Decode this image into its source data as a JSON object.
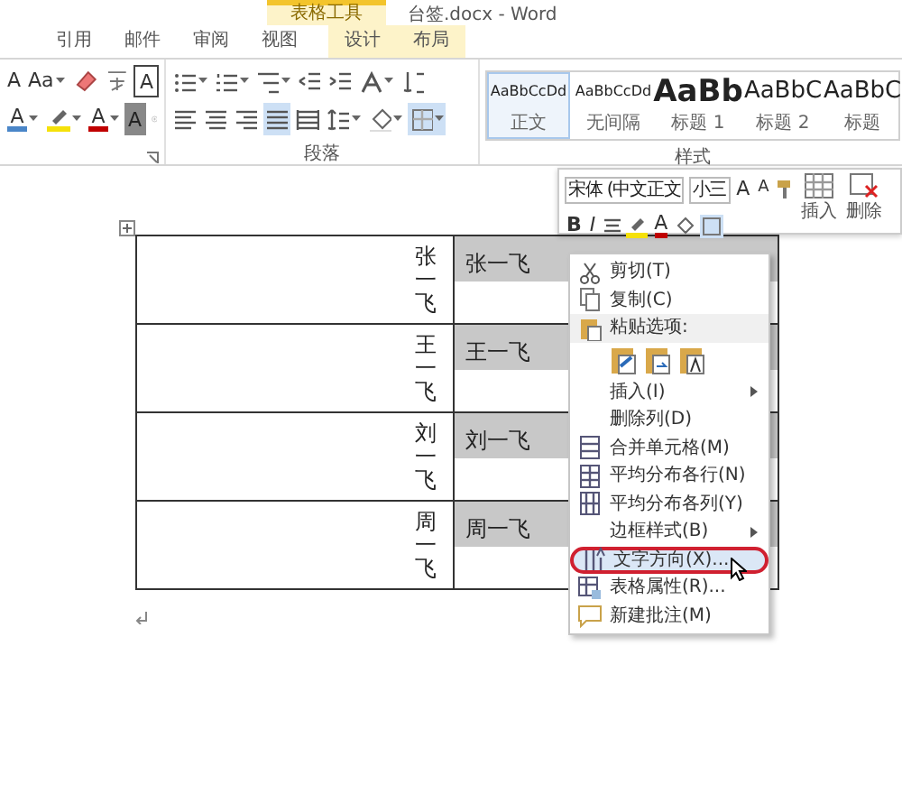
{
  "tool_header": "表格工具",
  "title": "台签.docx - Word",
  "tabs": [
    {
      "label": "引用",
      "selected": false,
      "kind": "main"
    },
    {
      "label": "邮件",
      "selected": false,
      "kind": "main"
    },
    {
      "label": "审阅",
      "selected": false,
      "kind": "main"
    },
    {
      "label": "视图",
      "selected": false,
      "kind": "main"
    },
    {
      "label": "设计",
      "selected": false,
      "kind": "tool"
    },
    {
      "label": "布局",
      "selected": false,
      "kind": "tool"
    }
  ],
  "font_group": {
    "rows": [
      [
        {
          "kind": "glyph",
          "text": "A"
        },
        {
          "kind": "glyph",
          "text": "Aa",
          "dropdown": true
        },
        {
          "kind": "icon"
        },
        {
          "kind": "icon"
        },
        {
          "kind": "boxed",
          "text": "A"
        }
      ],
      [
        {
          "kind": "glyph",
          "text": "A",
          "color": "#4a86c8",
          "dropdown": true
        },
        {
          "kind": "icon",
          "dropdown": true
        },
        {
          "kind": "glyph",
          "text": "A",
          "color": "#c00000",
          "dropdown": true
        },
        {
          "kind": "shaded",
          "text": "A"
        },
        {
          "kind": "icon"
        }
      ]
    ]
  },
  "paragraph_group": {
    "label": "段落",
    "rows": [
      [
        {
          "kind": "icon",
          "dropdown": true,
          "selected": false
        },
        {
          "kind": "icon",
          "dropdown": true,
          "selected": false
        },
        {
          "kind": "icon",
          "dropdown": true,
          "selected": false
        },
        {
          "kind": "icon",
          "selected": false
        },
        {
          "kind": "icon",
          "selected": false
        },
        {
          "kind": "icon",
          "dropdown": true,
          "selected": false
        },
        {
          "kind": "icon",
          "selected": false
        }
      ],
      [
        {
          "kind": "icon",
          "selected": false
        },
        {
          "kind": "icon",
          "selected": false
        },
        {
          "kind": "icon",
          "selected": false
        },
        {
          "kind": "icon",
          "selected": true
        },
        {
          "kind": "icon",
          "selected": false
        },
        {
          "kind": "icon",
          "dropdown": true,
          "selected": false
        },
        {
          "kind": "icon",
          "dropdown": true,
          "selected": false
        },
        {
          "kind": "icon",
          "dropdown": true,
          "selected": true
        }
      ]
    ]
  },
  "styles_group": {
    "label": "样式",
    "items": [
      {
        "sample": "AaBbCcDd",
        "name": "正文",
        "kind": "normal",
        "selected": true
      },
      {
        "sample": "AaBbCcDd",
        "name": "无间隔",
        "kind": "normal",
        "selected": false
      },
      {
        "sample": "AaBb",
        "name": "标题 1",
        "kind": "heading1",
        "selected": false
      },
      {
        "sample": "AaBbC",
        "name": "标题 2",
        "kind": "heading2",
        "selected": false
      },
      {
        "sample": "AaBbC",
        "name": "标题",
        "kind": "title",
        "selected": false
      }
    ]
  },
  "table": {
    "rows": [
      {
        "vertical": "张一飞",
        "name": "张一飞"
      },
      {
        "vertical": "王一飞",
        "name": "王一飞"
      },
      {
        "vertical": "刘一飞",
        "name": "刘一飞"
      },
      {
        "vertical": "周一飞",
        "name": "周一飞"
      }
    ]
  },
  "mini_toolbar": {
    "font": "宋体 (中文正文",
    "size": "小三",
    "grow": "A",
    "shrink": "A",
    "bold": "B",
    "italic": "I",
    "font_color": "A",
    "insert": "插入",
    "delete": "删除"
  },
  "context_menu": [
    {
      "kind": "cut",
      "label": "剪切(T)"
    },
    {
      "kind": "copy",
      "label": "复制(C)"
    },
    {
      "kind": "paste-header",
      "label": "粘贴选项:"
    },
    {
      "kind": "paste-options",
      "options": [
        {
          "kind": "keep"
        },
        {
          "kind": "merge"
        },
        {
          "kind": "text"
        }
      ]
    },
    {
      "kind": "plain",
      "label": "插入(I)",
      "submenu": true
    },
    {
      "kind": "plain",
      "label": "删除列(D)"
    },
    {
      "kind": "merge",
      "label": "合并单元格(M)"
    },
    {
      "kind": "rows",
      "label": "平均分布各行(N)"
    },
    {
      "kind": "cols",
      "label": "平均分布各列(Y)"
    },
    {
      "kind": "plain",
      "label": "边框样式(B)",
      "submenu": true
    },
    {
      "kind": "direction",
      "label": "文字方向(X)...",
      "highlighted": true
    },
    {
      "kind": "properties",
      "label": "表格属性(R)..."
    },
    {
      "kind": "comment",
      "label": "新建批注(M)"
    }
  ]
}
